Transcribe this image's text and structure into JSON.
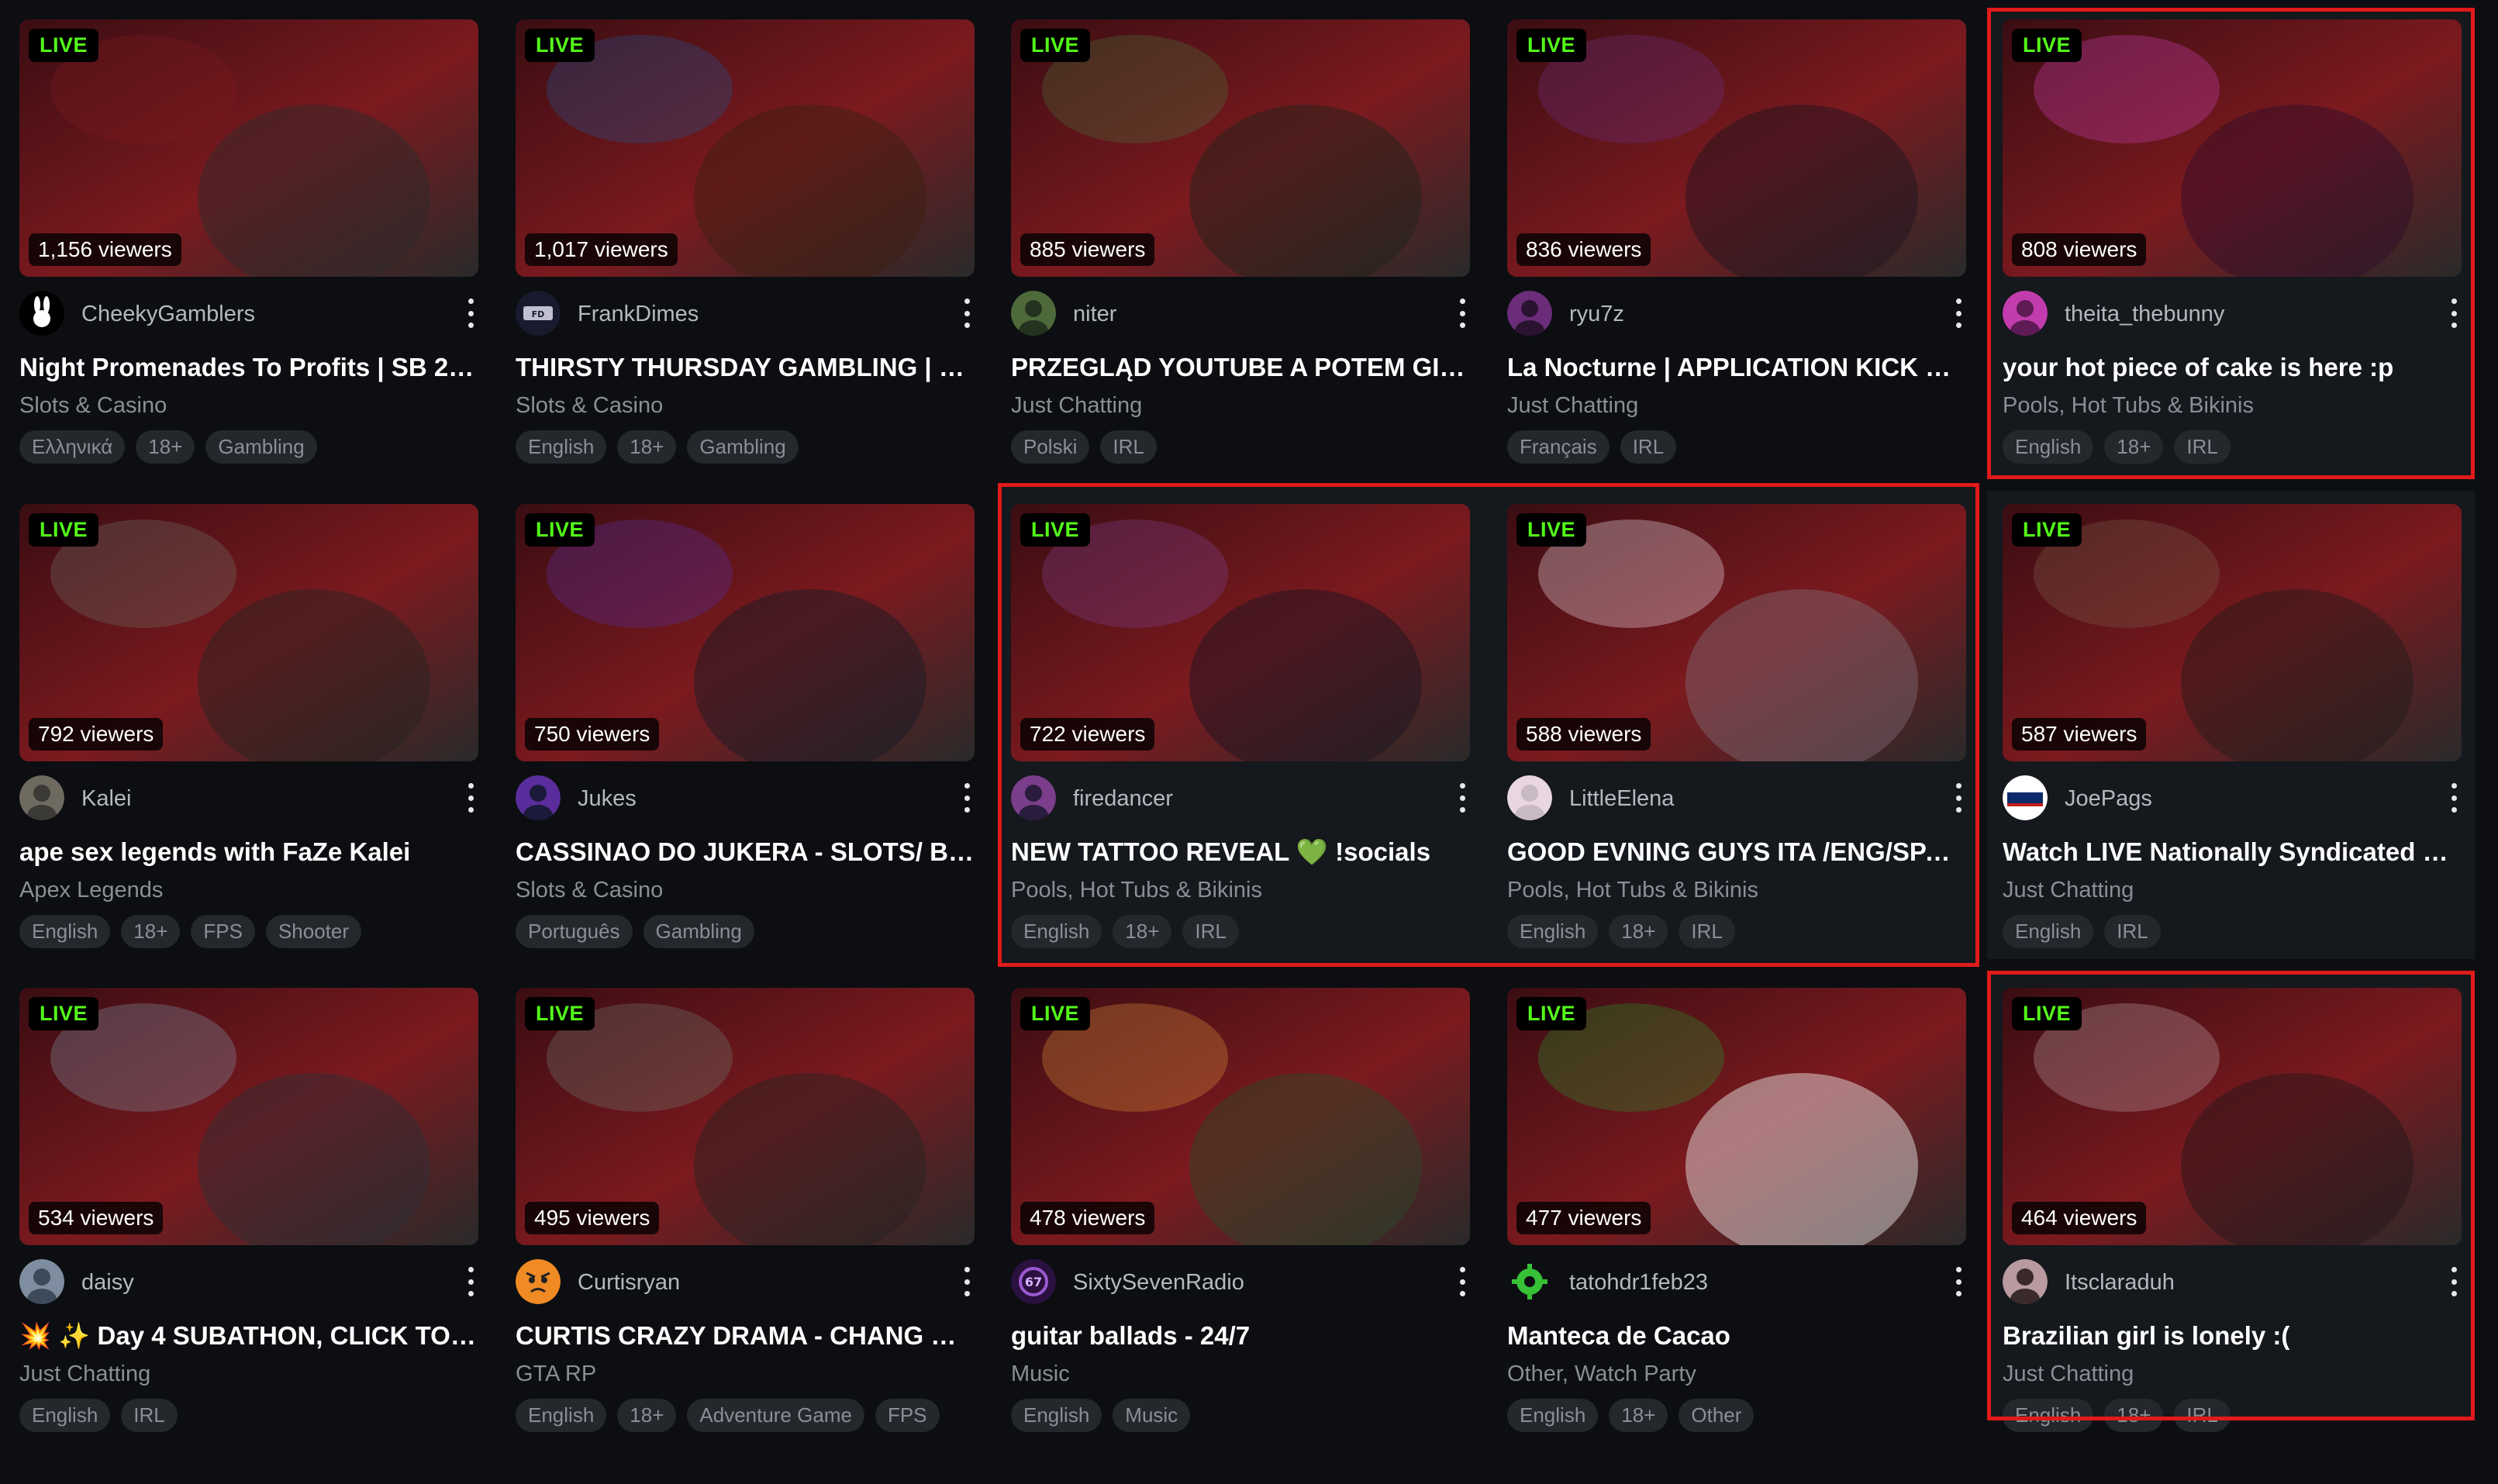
{
  "streams": [
    {
      "channel": "CheekyGamblers",
      "title": "Night Promenades To Profits | SB 2.…",
      "category": "Slots & Casino",
      "viewers": "1,156 viewers",
      "live": "LIVE",
      "tags": [
        "Ελληνικά",
        "18+",
        "Gambling"
      ],
      "icon": "rabbit-logo-icon",
      "colors": [
        "#3a0d12",
        "#7b1a1f",
        "#2a2a2a"
      ]
    },
    {
      "channel": "FrankDimes",
      "title": "THIRSTY THURSDAY GAMBLING | G…",
      "category": "Slots & Casino",
      "viewers": "1,017 viewers",
      "live": "LIVE",
      "tags": [
        "English",
        "18+",
        "Gambling"
      ],
      "icon": "frank-dimes-logo-icon",
      "colors": [
        "#0f2340",
        "#25508a",
        "#3a2010"
      ]
    },
    {
      "channel": "niter",
      "title": "PRZEGLĄD YOUTUBE A POTEM GIE…",
      "category": "Just Chatting",
      "viewers": "885 viewers",
      "live": "LIVE",
      "tags": [
        "Polski",
        "IRL"
      ],
      "icon": "avatar-icon",
      "colors": [
        "#243320",
        "#4e6a3a",
        "#1b2418"
      ]
    },
    {
      "channel": "ryu7z",
      "title": "La Nocturne | APPLICATION KICK di…",
      "category": "Just Chatting",
      "viewers": "836 viewers",
      "live": "LIVE",
      "tags": [
        "Français",
        "IRL"
      ],
      "icon": "avatar-icon",
      "colors": [
        "#2a1330",
        "#6b2d7a",
        "#1a1420"
      ]
    },
    {
      "channel": "theita_thebunny",
      "title": "your hot piece of cake is here :p",
      "category": "Pools, Hot Tubs & Bikinis",
      "viewers": "808 viewers",
      "live": "LIVE",
      "tags": [
        "English",
        "18+",
        "IRL"
      ],
      "icon": "avatar-icon",
      "colors": [
        "#5e1b55",
        "#c23cad",
        "#2c0c2a"
      ]
    },
    {
      "channel": "Kalei",
      "title": "ape sex legends with FaZe Kalei",
      "category": "Apex Legends",
      "viewers": "792 viewers",
      "live": "LIVE",
      "tags": [
        "English",
        "18+",
        "FPS",
        "Shooter"
      ],
      "icon": "avatar-icon",
      "colors": [
        "#3c3a36",
        "#6f6a60",
        "#232320"
      ]
    },
    {
      "channel": "Jukes",
      "title": "CASSINAO DO JUKERA - SLOTS/ BL…",
      "category": "Slots & Casino",
      "viewers": "750 viewers",
      "live": "LIVE",
      "tags": [
        "Português",
        "Gambling"
      ],
      "icon": "avatar-icon",
      "colors": [
        "#1c1a3a",
        "#5a2d9c",
        "#111a26"
      ]
    },
    {
      "channel": "firedancer",
      "title": "NEW TATTOO REVEAL 💚 !socials",
      "category": "Pools, Hot Tubs & Bikinis",
      "viewers": "722 viewers",
      "live": "LIVE",
      "tags": [
        "English",
        "18+",
        "IRL"
      ],
      "icon": "avatar-icon",
      "colors": [
        "#2a1c3e",
        "#7a3e8a",
        "#171322"
      ]
    },
    {
      "channel": "LittleElena",
      "title": "GOOD EVNING GUYS ITA /ENG/SPA …",
      "category": "Pools, Hot Tubs & Bikinis",
      "viewers": "588 viewers",
      "live": "LIVE",
      "tags": [
        "English",
        "18+",
        "IRL"
      ],
      "icon": "avatar-icon",
      "colors": [
        "#c9b9c4",
        "#e8d6e0",
        "#7e6a75"
      ]
    },
    {
      "channel": "JoePags",
      "title": "Watch LIVE Nationally Syndicated R…",
      "category": "Just Chatting",
      "viewers": "587 viewers",
      "live": "LIVE",
      "tags": [
        "English",
        "IRL"
      ],
      "icon": "joepags-logo-icon",
      "colors": [
        "#3a2a24",
        "#7a5a48",
        "#1e1a18"
      ]
    },
    {
      "channel": "daisy",
      "title": "💥 ✨ Day 4 SUBATHON, CLICK TO …",
      "category": "Just Chatting",
      "viewers": "534 viewers",
      "live": "LIVE",
      "tags": [
        "English",
        "IRL"
      ],
      "icon": "avatar-icon",
      "colors": [
        "#3d4a5a",
        "#7e8da0",
        "#2a2f36"
      ]
    },
    {
      "channel": "Curtisryan",
      "title": "CURTIS CRAZY DRAMA - CHANG G…",
      "category": "GTA RP",
      "viewers": "495 viewers",
      "live": "LIVE",
      "tags": [
        "English",
        "18+",
        "Adventure Game",
        "FPS"
      ],
      "icon": "angry-face-icon",
      "colors": [
        "#3b3d38",
        "#70736a",
        "#232421"
      ]
    },
    {
      "channel": "SixtySevenRadio",
      "title": "guitar ballads - 24/7",
      "category": "Music",
      "viewers": "478 viewers",
      "live": "LIVE",
      "tags": [
        "English",
        "Music"
      ],
      "icon": "radio-logo-icon",
      "colors": [
        "#1f3a22",
        "#d48a3a",
        "#2b4a2a"
      ]
    },
    {
      "channel": "tatohdr1feb23",
      "title": "Manteca de Cacao",
      "category": "Other, Watch Party",
      "viewers": "477 viewers",
      "live": "LIVE",
      "tags": [
        "English",
        "18+",
        "Other"
      ],
      "icon": "gear-logo-icon",
      "colors": [
        "#d8dcdc",
        "#2a8a2a",
        "#f0f2f2"
      ]
    },
    {
      "channel": "Itsclaraduh",
      "title": "Brazilian girl is lonely :(",
      "category": "Just Chatting",
      "viewers": "464 viewers",
      "live": "LIVE",
      "tags": [
        "English",
        "18+",
        "IRL"
      ],
      "icon": "avatar-icon",
      "colors": [
        "#3a2a2c",
        "#b89aa0",
        "#1e1618"
      ]
    }
  ],
  "highlight_color": "#e11a1a"
}
